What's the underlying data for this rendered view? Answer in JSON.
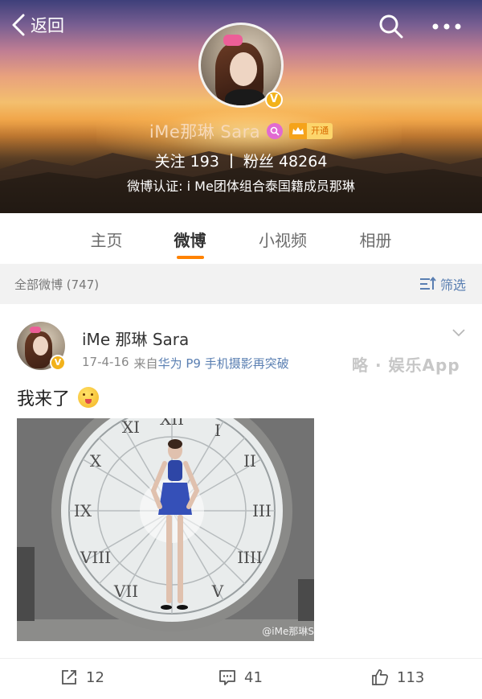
{
  "nav": {
    "back_label": "返回"
  },
  "profile": {
    "name": "iMe那琳 Sara",
    "vip_label": "开通",
    "following_label": "关注",
    "following_count": "193",
    "followers_label": "粉丝",
    "followers_count": "48264",
    "verification": "微博认证: i Me团体组合泰国籍成员那琳"
  },
  "tabs": [
    {
      "label": "主页",
      "active": false
    },
    {
      "label": "微博",
      "active": true
    },
    {
      "label": "小视频",
      "active": false
    },
    {
      "label": "相册",
      "active": false
    }
  ],
  "filter": {
    "count_label": "全部微博 (747)",
    "filter_label": "筛选"
  },
  "post": {
    "author": "iMe 那琳 Sara",
    "date": "17-4-16",
    "source_prefix": "来自",
    "source": "华为 P9 手机摄影再突破",
    "text": "我来了",
    "image_watermark": "@iMe那琳S",
    "reposts": "12",
    "comments": "41",
    "likes": "113"
  },
  "watermark": "略 · 娱乐App",
  "colors": {
    "accent": "#ff8200",
    "link": "#5a7fb2",
    "verified": "#f2b21b"
  },
  "icons": [
    "back-chevron-icon",
    "search-icon",
    "more-icon",
    "verified-icon",
    "tag-icon",
    "crown-icon",
    "filter-icon",
    "chevron-down-icon",
    "repost-icon",
    "comment-icon",
    "like-icon"
  ]
}
